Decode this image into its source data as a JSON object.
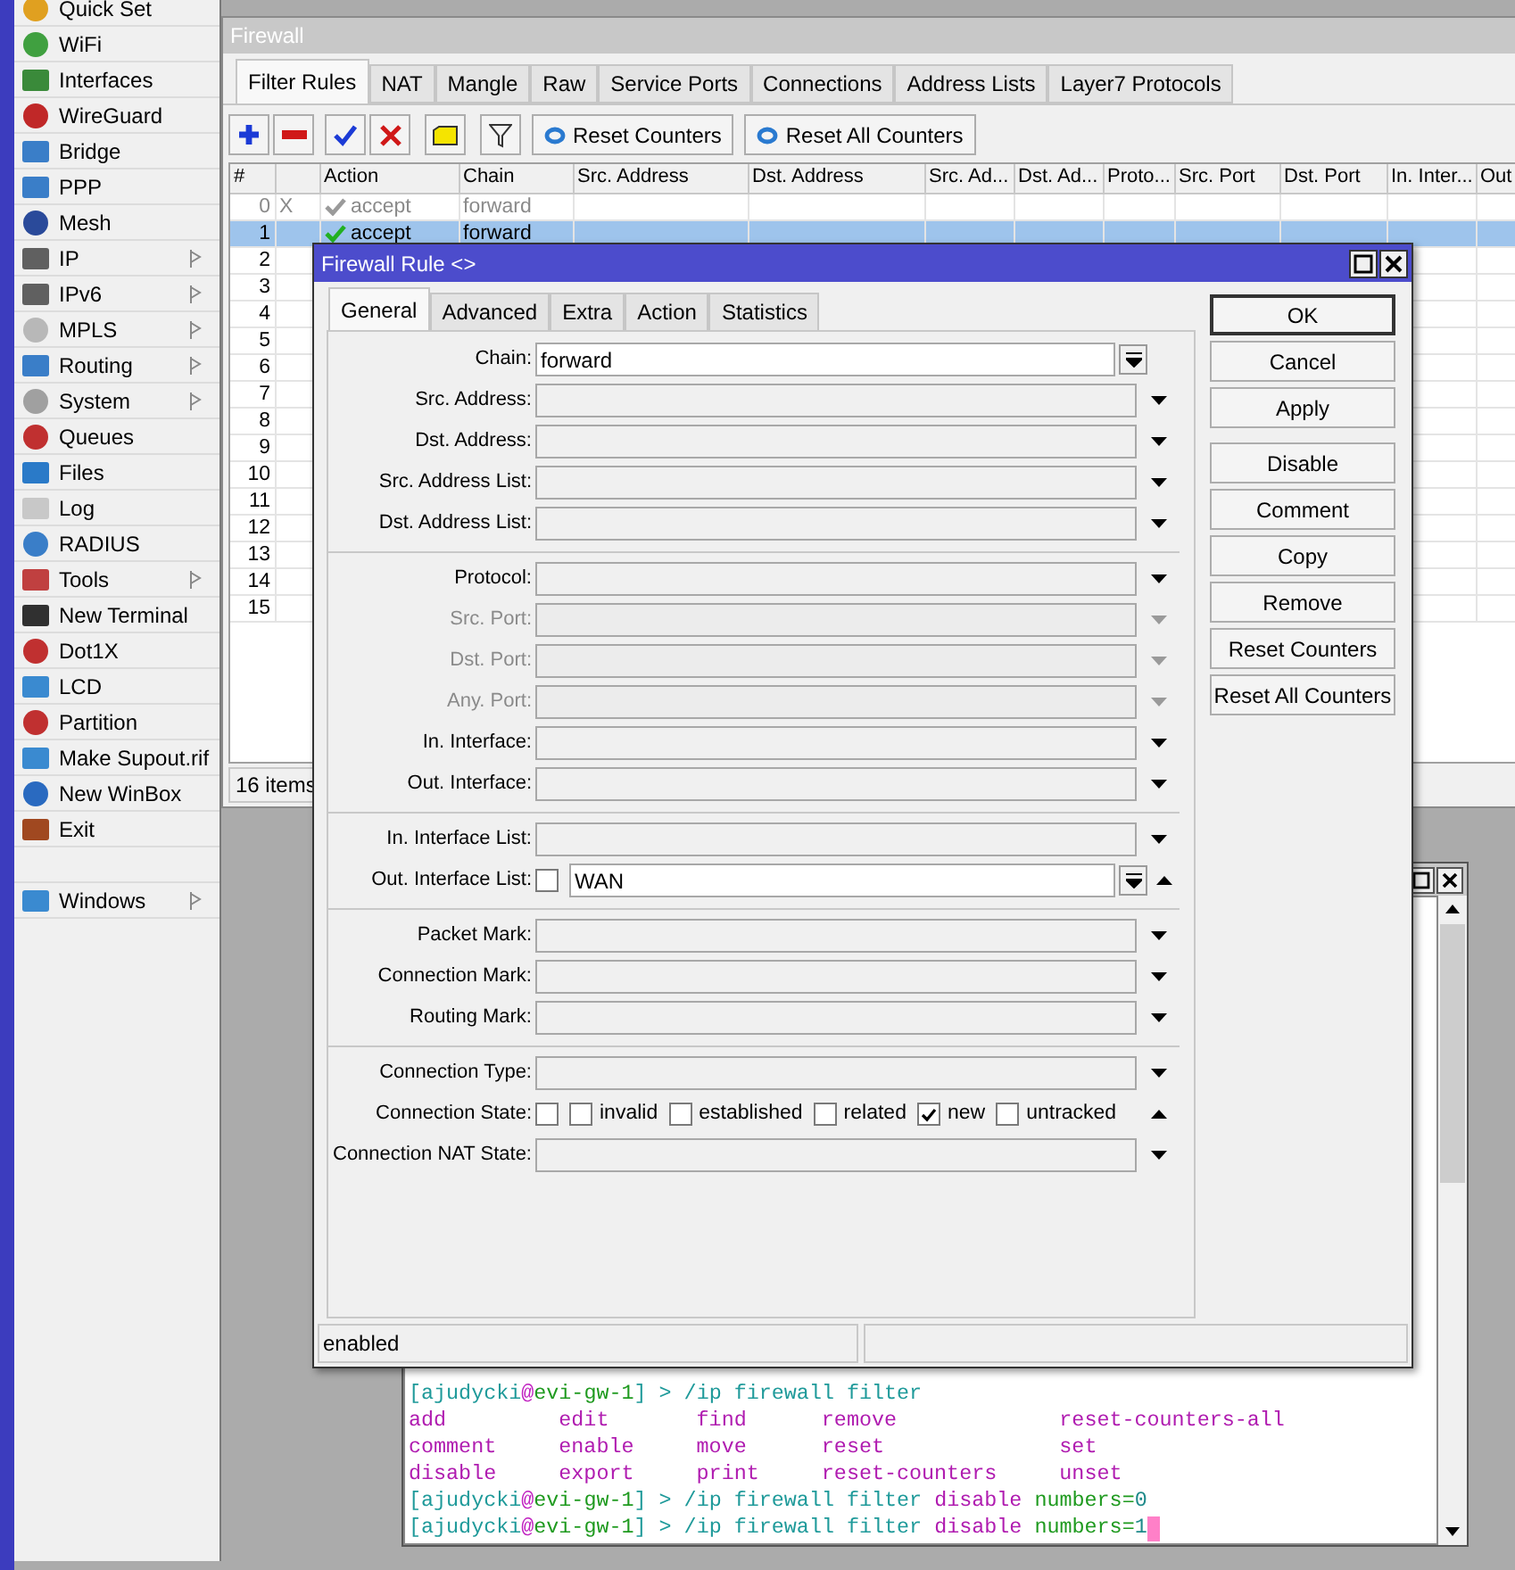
{
  "sidebar": {
    "items": [
      {
        "label": "Quick Set",
        "submenu": false
      },
      {
        "label": "WiFi",
        "submenu": false
      },
      {
        "label": "Interfaces",
        "submenu": false
      },
      {
        "label": "WireGuard",
        "submenu": false
      },
      {
        "label": "Bridge",
        "submenu": false
      },
      {
        "label": "PPP",
        "submenu": false
      },
      {
        "label": "Mesh",
        "submenu": false
      },
      {
        "label": "IP",
        "submenu": true
      },
      {
        "label": "IPv6",
        "submenu": true
      },
      {
        "label": "MPLS",
        "submenu": true
      },
      {
        "label": "Routing",
        "submenu": true
      },
      {
        "label": "System",
        "submenu": true
      },
      {
        "label": "Queues",
        "submenu": false
      },
      {
        "label": "Files",
        "submenu": false
      },
      {
        "label": "Log",
        "submenu": false
      },
      {
        "label": "RADIUS",
        "submenu": false
      },
      {
        "label": "Tools",
        "submenu": true
      },
      {
        "label": "New Terminal",
        "submenu": false
      },
      {
        "label": "Dot1X",
        "submenu": false
      },
      {
        "label": "LCD",
        "submenu": false
      },
      {
        "label": "Partition",
        "submenu": false
      },
      {
        "label": "Make Supout.rif",
        "submenu": false
      },
      {
        "label": "New WinBox",
        "submenu": false
      },
      {
        "label": "Exit",
        "submenu": false
      }
    ],
    "footer_items": [
      {
        "label": "Windows",
        "submenu": true
      }
    ]
  },
  "firewall": {
    "title": "Firewall",
    "tabs": [
      {
        "label": "Filter Rules",
        "selected": true
      },
      {
        "label": "NAT",
        "selected": false
      },
      {
        "label": "Mangle",
        "selected": false
      },
      {
        "label": "Raw",
        "selected": false
      },
      {
        "label": "Service Ports",
        "selected": false
      },
      {
        "label": "Connections",
        "selected": false
      },
      {
        "label": "Address Lists",
        "selected": false
      },
      {
        "label": "Layer7 Protocols",
        "selected": false
      }
    ],
    "toolbar": [
      {
        "kind": "add"
      },
      {
        "kind": "remove"
      },
      {
        "kind": "enable"
      },
      {
        "kind": "disable"
      },
      {
        "kind": "comment"
      },
      {
        "kind": "filter"
      },
      {
        "kind": "reset",
        "label": "Reset Counters"
      },
      {
        "kind": "reset",
        "label": "Reset All Counters"
      }
    ],
    "table": {
      "columns": [
        "#",
        "Action",
        "Chain",
        "Src. Address",
        "Dst. Address",
        "Src. Ad...",
        "Dst. Ad...",
        "Proto...",
        "Src. Port",
        "Dst. Port",
        "In. Inter...",
        "Out"
      ],
      "rows": [
        {
          "number": "0",
          "flag": "X",
          "action": "accept",
          "chain": "forward",
          "disabled": true,
          "selected": false
        },
        {
          "number": "1",
          "action": "accept",
          "chain": "forward",
          "disabled": false,
          "selected": true
        },
        {
          "number": "2",
          "disabled": false,
          "selected": false
        },
        {
          "number": "3",
          "disabled": false,
          "selected": false
        },
        {
          "number": "4",
          "disabled": false,
          "selected": false
        },
        {
          "number": "5",
          "disabled": false,
          "selected": false
        },
        {
          "number": "6",
          "disabled": false,
          "selected": false
        },
        {
          "number": "7",
          "disabled": false,
          "selected": false
        },
        {
          "number": "8",
          "disabled": false,
          "selected": false
        },
        {
          "number": "9",
          "disabled": false,
          "selected": false
        },
        {
          "number": "10",
          "disabled": false,
          "selected": false
        },
        {
          "number": "11",
          "disabled": false,
          "selected": false
        },
        {
          "number": "12",
          "disabled": false,
          "selected": false
        },
        {
          "number": "13",
          "disabled": false,
          "selected": false
        },
        {
          "number": "14",
          "disabled": false,
          "selected": false
        },
        {
          "number": "15",
          "disabled": false,
          "selected": false
        }
      ]
    },
    "status": "16 items"
  },
  "terminal": {
    "lines": [
      {
        "kind": "prompt",
        "segments": [
          {
            "text": "[ajudycki",
            "kind": "path"
          },
          {
            "text": "@",
            "kind": "at"
          },
          {
            "text": "evi-gw-1",
            "kind": "host"
          },
          {
            "text": "] > /ip firewall filter",
            "kind": "path"
          }
        ]
      },
      {
        "kind": "commands",
        "words": [
          {
            "text": "add",
            "kind": "cmd"
          },
          {
            "text": "edit",
            "kind": "cmd"
          },
          {
            "text": "find",
            "kind": "cmd"
          },
          {
            "text": "remove",
            "kind": "cmd"
          },
          {
            "text": "reset-counters-all",
            "kind": "cmd"
          }
        ]
      },
      {
        "kind": "commands",
        "words": [
          {
            "text": "comment",
            "kind": "cmd"
          },
          {
            "text": "enable",
            "kind": "cmd"
          },
          {
            "text": "move",
            "kind": "cmd"
          },
          {
            "text": "reset",
            "kind": "cmd"
          },
          {
            "text": "set",
            "kind": "cmd"
          }
        ]
      },
      {
        "kind": "commands",
        "words": [
          {
            "text": "disable",
            "kind": "cmd"
          },
          {
            "text": "export",
            "kind": "cmd"
          },
          {
            "text": "print",
            "kind": "cmd"
          },
          {
            "text": "reset-counters",
            "kind": "cmd"
          },
          {
            "text": "unset",
            "kind": "cmd"
          }
        ]
      },
      {
        "kind": "prompt",
        "segments": [
          {
            "text": "[ajudycki",
            "kind": "path"
          },
          {
            "text": "@",
            "kind": "at"
          },
          {
            "text": "evi-gw-1",
            "kind": "host"
          },
          {
            "text": "] > /ip firewall filter",
            "kind": "path"
          },
          {
            "text": "disable",
            "kind": "cmd"
          },
          {
            "text": "numbers=",
            "kind": "param"
          },
          {
            "text": "0",
            "kind": "value"
          }
        ]
      },
      {
        "kind": "prompt",
        "cursor": true,
        "segments": [
          {
            "text": "[ajudycki",
            "kind": "path"
          },
          {
            "text": "@",
            "kind": "at"
          },
          {
            "text": "evi-gw-1",
            "kind": "host"
          },
          {
            "text": "] > /ip firewall filter",
            "kind": "path"
          },
          {
            "text": "disable",
            "kind": "cmd"
          },
          {
            "text": "numbers=",
            "kind": "param"
          },
          {
            "text": "1",
            "kind": "value"
          }
        ]
      }
    ]
  },
  "dialog": {
    "title": "Firewall Rule <>",
    "tabs": [
      {
        "label": "General",
        "selected": true
      },
      {
        "label": "Advanced",
        "selected": false
      },
      {
        "label": "Extra",
        "selected": false
      },
      {
        "label": "Action",
        "selected": false
      },
      {
        "label": "Statistics",
        "selected": false
      }
    ],
    "sections": [
      {
        "fields": [
          {
            "label": "Chain:",
            "kind": "combo",
            "value": "forward",
            "disabled": false
          },
          {
            "label": "Src. Address:",
            "kind": "dropdown",
            "disabled": false
          },
          {
            "label": "Dst. Address:",
            "kind": "dropdown",
            "disabled": false
          },
          {
            "label": "Src. Address List:",
            "kind": "dropdown",
            "disabled": false
          },
          {
            "label": "Dst. Address List:",
            "kind": "dropdown",
            "disabled": false
          }
        ]
      },
      {
        "fields": [
          {
            "label": "Protocol:",
            "kind": "dropdown",
            "disabled": false
          },
          {
            "label": "Src. Port:",
            "kind": "dropdown",
            "disabled": true
          },
          {
            "label": "Dst. Port:",
            "kind": "dropdown",
            "disabled": true
          },
          {
            "label": "Any. Port:",
            "kind": "dropdown",
            "disabled": true
          },
          {
            "label": "In. Interface:",
            "kind": "dropdown",
            "disabled": false
          },
          {
            "label": "Out. Interface:",
            "kind": "dropdown",
            "disabled": false
          }
        ]
      },
      {
        "fields": [
          {
            "label": "In. Interface List:",
            "kind": "dropdown",
            "disabled": false
          },
          {
            "label": "Out. Interface List:",
            "kind": "list",
            "negated": false,
            "value": "WAN",
            "disabled": false
          }
        ]
      },
      {
        "fields": [
          {
            "label": "Packet Mark:",
            "kind": "dropdown",
            "disabled": false
          },
          {
            "label": "Connection Mark:",
            "kind": "dropdown",
            "disabled": false
          },
          {
            "label": "Routing Mark:",
            "kind": "dropdown",
            "disabled": false
          }
        ]
      },
      {
        "fields": [
          {
            "label": "Connection Type:",
            "kind": "dropdown",
            "disabled": false
          },
          {
            "label": "Connection State:",
            "kind": "checks",
            "negated": false,
            "disabled": false,
            "options": [
              {
                "label": "invalid",
                "checked": false
              },
              {
                "label": "established",
                "checked": false
              },
              {
                "label": "related",
                "checked": false
              },
              {
                "label": "new",
                "checked": true
              },
              {
                "label": "untracked",
                "checked": false
              }
            ]
          },
          {
            "label": "Connection NAT State:",
            "kind": "dropdown",
            "disabled": false
          }
        ]
      }
    ],
    "button_groups": [
      [
        {
          "label": "OK",
          "default": true
        },
        {
          "label": "Cancel",
          "default": false
        },
        {
          "label": "Apply",
          "default": false
        }
      ],
      [
        {
          "label": "Disable",
          "default": false
        },
        {
          "label": "Comment",
          "default": false
        },
        {
          "label": "Copy",
          "default": false
        },
        {
          "label": "Remove",
          "default": false
        },
        {
          "label": "Reset Counters",
          "default": false
        },
        {
          "label": "Reset All Counters",
          "default": false
        }
      ]
    ],
    "status": "enabled"
  }
}
